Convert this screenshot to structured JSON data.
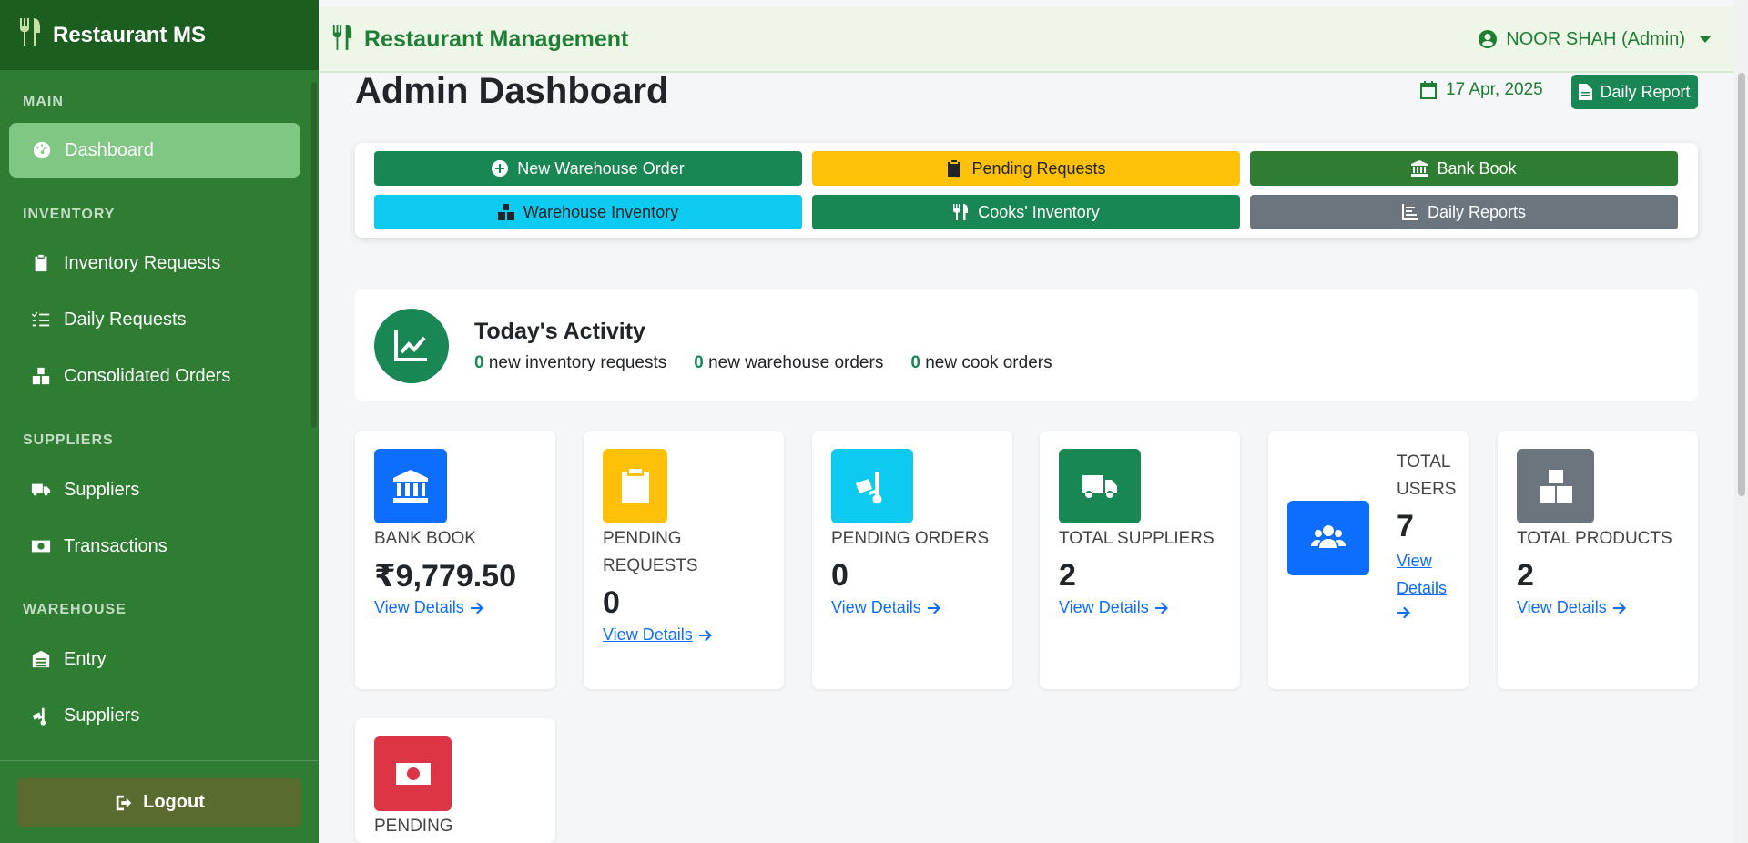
{
  "sidebar": {
    "brand": "Restaurant MS",
    "sections": {
      "main": "MAIN",
      "inventory": "INVENTORY",
      "suppliers": "SUPPLIERS",
      "warehouse": "WAREHOUSE"
    },
    "items": {
      "dashboard": "Dashboard",
      "inventory_requests": "Inventory Requests",
      "daily_requests": "Daily Requests",
      "consolidated_orders": "Consolidated Orders",
      "suppliers": "Suppliers",
      "transactions": "Transactions",
      "entry": "Entry",
      "warehouse_suppliers": "Suppliers"
    },
    "logout": "Logout"
  },
  "header": {
    "title": "Restaurant Management",
    "user": "NOOR SHAH (Admin)"
  },
  "page": {
    "title": "Admin Dashboard",
    "date": "17 Apr, 2025",
    "daily_report_button": "Daily Report"
  },
  "quick_actions": {
    "new_warehouse_order": "New Warehouse Order",
    "pending_requests": "Pending Requests",
    "bank_book": "Bank Book",
    "warehouse_inventory": "Warehouse Inventory",
    "cooks_inventory": "Cooks' Inventory",
    "daily_reports": "Daily Reports"
  },
  "activity": {
    "title": "Today's Activity",
    "inventory_requests_count": "0",
    "inventory_requests_text": "new inventory requests",
    "warehouse_orders_count": "0",
    "warehouse_orders_text": "new warehouse orders",
    "cook_orders_count": "0",
    "cook_orders_text": "new cook orders"
  },
  "stats": {
    "bank_book": {
      "label": "BANK BOOK",
      "value": "₹9,779.50",
      "link": "View Details"
    },
    "pending_requests": {
      "label": "PENDING REQUESTS",
      "value": "0",
      "link": "View Details"
    },
    "pending_orders": {
      "label": "PENDING ORDERS",
      "value": "0",
      "link": "View Details"
    },
    "total_suppliers": {
      "label": "TOTAL SUPPLIERS",
      "value": "2",
      "link": "View Details"
    },
    "total_users": {
      "label": "TOTAL USERS",
      "value": "7",
      "link": "View Details"
    },
    "total_products": {
      "label": "TOTAL PRODUCTS",
      "value": "2",
      "link": "View Details"
    },
    "pending_payments": {
      "label": "PENDING"
    }
  },
  "colors": {
    "sidebar": "#2e7d32",
    "brand_bar": "#1b5e20",
    "success": "#198754",
    "warning": "#ffc107",
    "info": "#0dcaf0",
    "primary": "#0d6efd",
    "secondary": "#6c757d",
    "danger": "#dc3545",
    "bank_book_btn": "#2e7d32"
  }
}
